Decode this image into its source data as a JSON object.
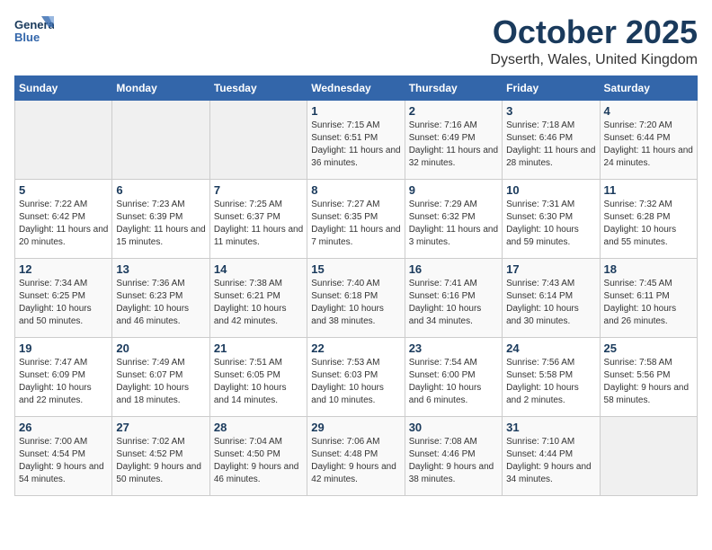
{
  "header": {
    "logo_text_general": "General",
    "logo_text_blue": "Blue",
    "month_title": "October 2025",
    "location": "Dyserth, Wales, United Kingdom"
  },
  "days_of_week": [
    "Sunday",
    "Monday",
    "Tuesday",
    "Wednesday",
    "Thursday",
    "Friday",
    "Saturday"
  ],
  "weeks": [
    [
      {
        "day": "",
        "sunrise": "",
        "sunset": "",
        "daylight": ""
      },
      {
        "day": "",
        "sunrise": "",
        "sunset": "",
        "daylight": ""
      },
      {
        "day": "",
        "sunrise": "",
        "sunset": "",
        "daylight": ""
      },
      {
        "day": "1",
        "sunrise": "Sunrise: 7:15 AM",
        "sunset": "Sunset: 6:51 PM",
        "daylight": "Daylight: 11 hours and 36 minutes."
      },
      {
        "day": "2",
        "sunrise": "Sunrise: 7:16 AM",
        "sunset": "Sunset: 6:49 PM",
        "daylight": "Daylight: 11 hours and 32 minutes."
      },
      {
        "day": "3",
        "sunrise": "Sunrise: 7:18 AM",
        "sunset": "Sunset: 6:46 PM",
        "daylight": "Daylight: 11 hours and 28 minutes."
      },
      {
        "day": "4",
        "sunrise": "Sunrise: 7:20 AM",
        "sunset": "Sunset: 6:44 PM",
        "daylight": "Daylight: 11 hours and 24 minutes."
      }
    ],
    [
      {
        "day": "5",
        "sunrise": "Sunrise: 7:22 AM",
        "sunset": "Sunset: 6:42 PM",
        "daylight": "Daylight: 11 hours and 20 minutes."
      },
      {
        "day": "6",
        "sunrise": "Sunrise: 7:23 AM",
        "sunset": "Sunset: 6:39 PM",
        "daylight": "Daylight: 11 hours and 15 minutes."
      },
      {
        "day": "7",
        "sunrise": "Sunrise: 7:25 AM",
        "sunset": "Sunset: 6:37 PM",
        "daylight": "Daylight: 11 hours and 11 minutes."
      },
      {
        "day": "8",
        "sunrise": "Sunrise: 7:27 AM",
        "sunset": "Sunset: 6:35 PM",
        "daylight": "Daylight: 11 hours and 7 minutes."
      },
      {
        "day": "9",
        "sunrise": "Sunrise: 7:29 AM",
        "sunset": "Sunset: 6:32 PM",
        "daylight": "Daylight: 11 hours and 3 minutes."
      },
      {
        "day": "10",
        "sunrise": "Sunrise: 7:31 AM",
        "sunset": "Sunset: 6:30 PM",
        "daylight": "Daylight: 10 hours and 59 minutes."
      },
      {
        "day": "11",
        "sunrise": "Sunrise: 7:32 AM",
        "sunset": "Sunset: 6:28 PM",
        "daylight": "Daylight: 10 hours and 55 minutes."
      }
    ],
    [
      {
        "day": "12",
        "sunrise": "Sunrise: 7:34 AM",
        "sunset": "Sunset: 6:25 PM",
        "daylight": "Daylight: 10 hours and 50 minutes."
      },
      {
        "day": "13",
        "sunrise": "Sunrise: 7:36 AM",
        "sunset": "Sunset: 6:23 PM",
        "daylight": "Daylight: 10 hours and 46 minutes."
      },
      {
        "day": "14",
        "sunrise": "Sunrise: 7:38 AM",
        "sunset": "Sunset: 6:21 PM",
        "daylight": "Daylight: 10 hours and 42 minutes."
      },
      {
        "day": "15",
        "sunrise": "Sunrise: 7:40 AM",
        "sunset": "Sunset: 6:18 PM",
        "daylight": "Daylight: 10 hours and 38 minutes."
      },
      {
        "day": "16",
        "sunrise": "Sunrise: 7:41 AM",
        "sunset": "Sunset: 6:16 PM",
        "daylight": "Daylight: 10 hours and 34 minutes."
      },
      {
        "day": "17",
        "sunrise": "Sunrise: 7:43 AM",
        "sunset": "Sunset: 6:14 PM",
        "daylight": "Daylight: 10 hours and 30 minutes."
      },
      {
        "day": "18",
        "sunrise": "Sunrise: 7:45 AM",
        "sunset": "Sunset: 6:11 PM",
        "daylight": "Daylight: 10 hours and 26 minutes."
      }
    ],
    [
      {
        "day": "19",
        "sunrise": "Sunrise: 7:47 AM",
        "sunset": "Sunset: 6:09 PM",
        "daylight": "Daylight: 10 hours and 22 minutes."
      },
      {
        "day": "20",
        "sunrise": "Sunrise: 7:49 AM",
        "sunset": "Sunset: 6:07 PM",
        "daylight": "Daylight: 10 hours and 18 minutes."
      },
      {
        "day": "21",
        "sunrise": "Sunrise: 7:51 AM",
        "sunset": "Sunset: 6:05 PM",
        "daylight": "Daylight: 10 hours and 14 minutes."
      },
      {
        "day": "22",
        "sunrise": "Sunrise: 7:53 AM",
        "sunset": "Sunset: 6:03 PM",
        "daylight": "Daylight: 10 hours and 10 minutes."
      },
      {
        "day": "23",
        "sunrise": "Sunrise: 7:54 AM",
        "sunset": "Sunset: 6:00 PM",
        "daylight": "Daylight: 10 hours and 6 minutes."
      },
      {
        "day": "24",
        "sunrise": "Sunrise: 7:56 AM",
        "sunset": "Sunset: 5:58 PM",
        "daylight": "Daylight: 10 hours and 2 minutes."
      },
      {
        "day": "25",
        "sunrise": "Sunrise: 7:58 AM",
        "sunset": "Sunset: 5:56 PM",
        "daylight": "Daylight: 9 hours and 58 minutes."
      }
    ],
    [
      {
        "day": "26",
        "sunrise": "Sunrise: 7:00 AM",
        "sunset": "Sunset: 4:54 PM",
        "daylight": "Daylight: 9 hours and 54 minutes."
      },
      {
        "day": "27",
        "sunrise": "Sunrise: 7:02 AM",
        "sunset": "Sunset: 4:52 PM",
        "daylight": "Daylight: 9 hours and 50 minutes."
      },
      {
        "day": "28",
        "sunrise": "Sunrise: 7:04 AM",
        "sunset": "Sunset: 4:50 PM",
        "daylight": "Daylight: 9 hours and 46 minutes."
      },
      {
        "day": "29",
        "sunrise": "Sunrise: 7:06 AM",
        "sunset": "Sunset: 4:48 PM",
        "daylight": "Daylight: 9 hours and 42 minutes."
      },
      {
        "day": "30",
        "sunrise": "Sunrise: 7:08 AM",
        "sunset": "Sunset: 4:46 PM",
        "daylight": "Daylight: 9 hours and 38 minutes."
      },
      {
        "day": "31",
        "sunrise": "Sunrise: 7:10 AM",
        "sunset": "Sunset: 4:44 PM",
        "daylight": "Daylight: 9 hours and 34 minutes."
      },
      {
        "day": "",
        "sunrise": "",
        "sunset": "",
        "daylight": ""
      }
    ]
  ]
}
